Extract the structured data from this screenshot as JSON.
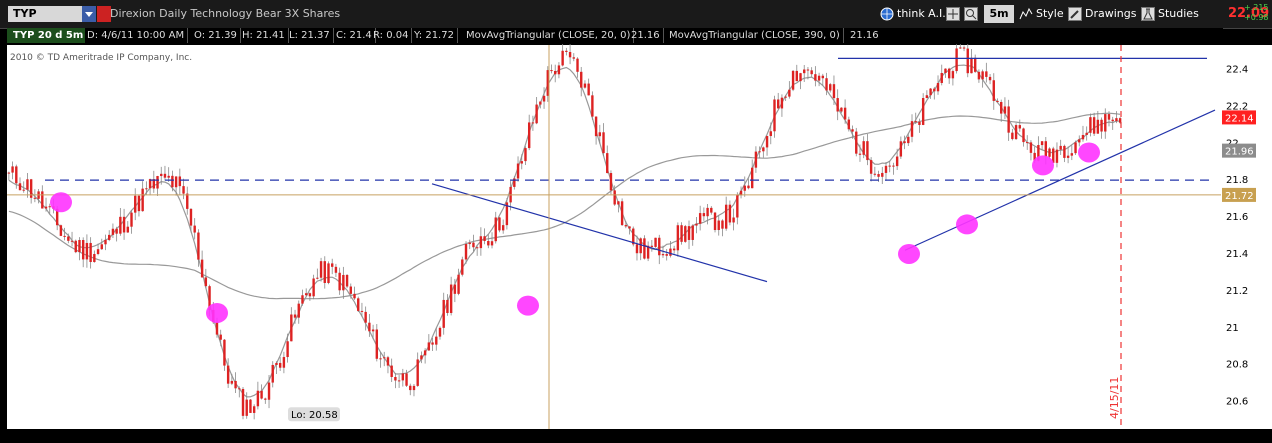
{
  "toolbar": {
    "symbol": "TYP",
    "description": "Direxion Daily Technology Bear 3X Shares",
    "think_ai": "think A.I.",
    "timeframe": "5m",
    "style": "Style",
    "drawings": "Drawings",
    "studies": "Studies",
    "last_price": "22.09",
    "change": "+.215",
    "change_pct": "+0.98"
  },
  "infobar": {
    "aggregation": "TYP 20 d 5m",
    "date": "D: 4/6/11 10:00 AM",
    "open": "O: 21.39",
    "high": "H: 21.41",
    "low": "L: 21.37",
    "close": "C: 21.4",
    "range": "R: 0.04",
    "cursor_y": "Y: 21.72",
    "study1": "MovAvgTriangular (CLOSE, 20, 0)",
    "study1_value": "21.16",
    "study2": "MovAvgTriangular (CLOSE, 390, 0)",
    "study2_value": "21.16"
  },
  "copyright": "2010 © TD Ameritrade IP Company, Inc.",
  "colors": {
    "background": "#ffffff",
    "candle": "#dd2222",
    "trendline": "#2233aa",
    "moving_average": "#999999",
    "crosshair": "#c8a060",
    "marker": "#ff33ff",
    "vertical_marker": "#ee3333",
    "price_tag_last": "#ff2020",
    "price_tag_ma": "#8c8c8c",
    "price_tag_cursor": "#c8a050"
  },
  "chart_data": {
    "type": "candlestick",
    "y_axis": {
      "range": [
        20.5,
        22.5
      ],
      "ticks": [
        "22.4",
        "22.2",
        "22",
        "21.8",
        "21.6",
        "21.4",
        "21.2",
        "21",
        "20.8",
        "20.6"
      ]
    },
    "price_labels": {
      "last": "22.14",
      "moving_average": "21.96",
      "cursor": "21.72"
    },
    "annotations": {
      "low_label": "Lo: 20.58",
      "date_marker": "4/15/11"
    },
    "key_points": [
      21.82,
      21.42,
      21.8,
      20.58,
      21.3,
      20.72,
      21.5,
      22.45,
      21.42,
      21.6,
      22.4,
      21.88,
      22.45,
      21.95,
      22.14
    ],
    "resistance_level": 21.8,
    "top_level": 22.46
  }
}
